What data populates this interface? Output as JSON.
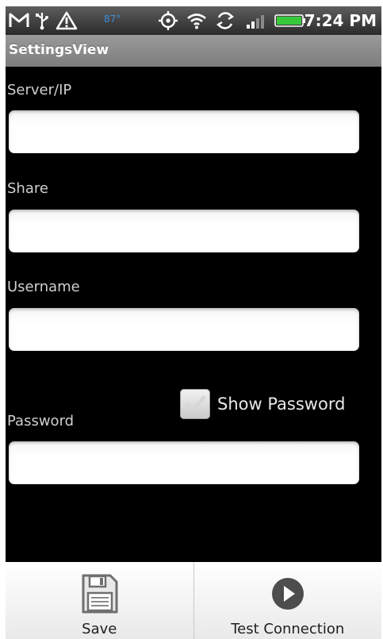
{
  "status_bar": {
    "temperature": "87°",
    "time": "7:24 PM",
    "icons": [
      "gmail-icon",
      "usb-icon",
      "warning-icon",
      "gps-icon",
      "wifi-icon",
      "sync-icon",
      "signal-icon",
      "battery-icon"
    ]
  },
  "title_bar": {
    "title": "SettingsView"
  },
  "form": {
    "server": {
      "label": "Server/IP",
      "value": ""
    },
    "share": {
      "label": "Share",
      "value": ""
    },
    "username": {
      "label": "Username",
      "value": ""
    },
    "password": {
      "label": "Password",
      "value": ""
    },
    "show_password": {
      "label": "Show Password",
      "checked": false
    }
  },
  "bottom_bar": {
    "save_label": "Save",
    "test_label": "Test Connection"
  }
}
